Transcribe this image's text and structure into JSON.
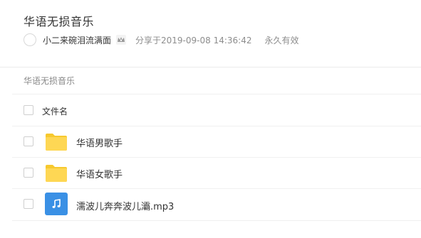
{
  "share": {
    "title": "华语无损音乐",
    "username": "小二来碗泪流满面",
    "shared_at": "分享于2019-09-08 14:36:42",
    "validity": "永久有效"
  },
  "breadcrumb": "华语无损音乐",
  "file_list": {
    "column_name": "文件名",
    "files": [
      {
        "name": "华语男歌手",
        "type": "folder",
        "icon": "folder-icon"
      },
      {
        "name": "华语女歌手",
        "type": "folder",
        "icon": "folder-icon"
      },
      {
        "name": "濡波儿奔奔波儿灞.mp3",
        "type": "audio",
        "icon": "music-note-icon"
      }
    ]
  },
  "colors": {
    "folder": "#fed754",
    "folder_tab": "#f7c92e",
    "audio_icon": "#3a90e5"
  }
}
